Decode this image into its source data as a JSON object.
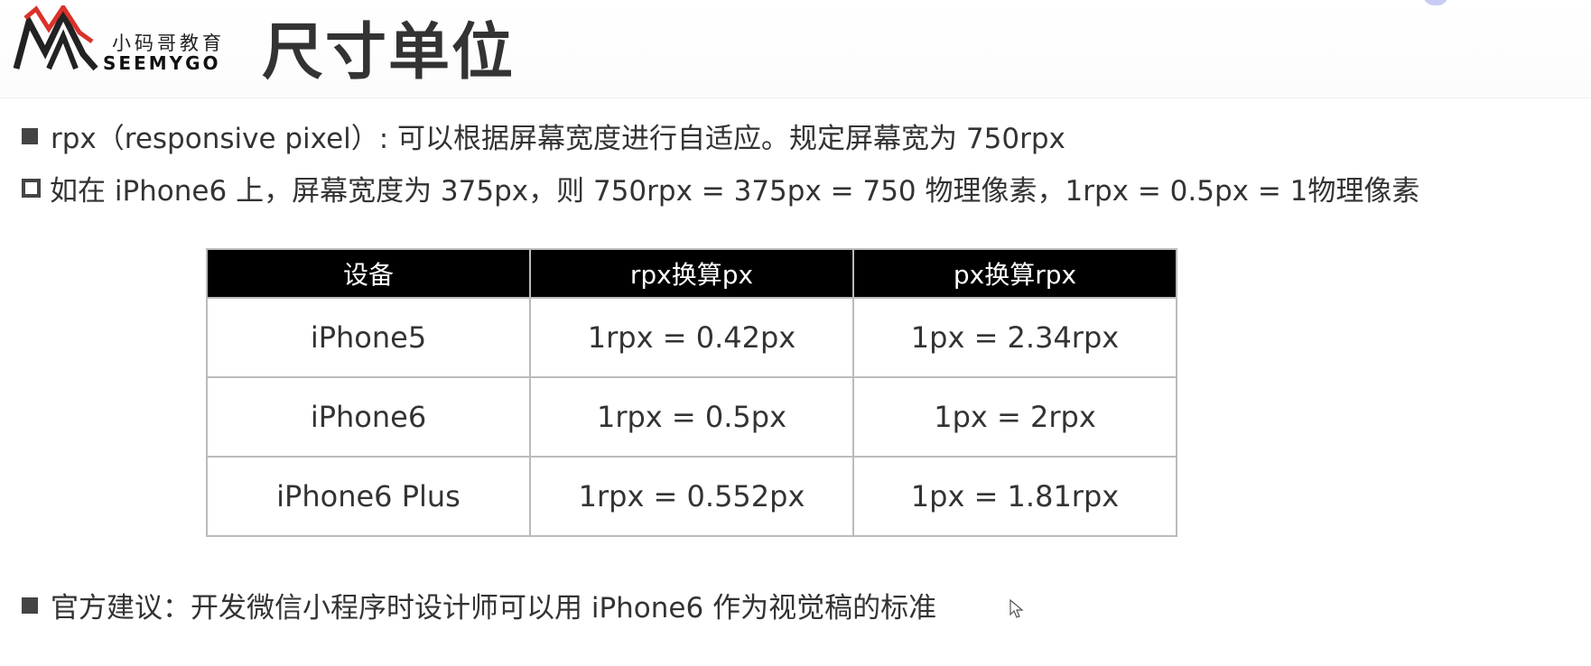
{
  "header": {
    "logo_cn": "小码哥教育",
    "logo_en": "SEEMYGO",
    "title": "尺寸单位"
  },
  "bullets": [
    {
      "style": "filled-square",
      "text": "rpx（responsive pixel）: 可以根据屏幕宽度进行自适应。规定屏幕宽为 750rpx"
    },
    {
      "style": "hollow-square",
      "text": "如在 iPhone6 上，屏幕宽度为 375px，则 750rpx = 375px = 750 物理像素，1rpx = 0.5px = 1物理像素"
    },
    {
      "style": "filled-square",
      "text": "官方建议：开发微信小程序时设计师可以用 iPhone6 作为视觉稿的标准"
    }
  ],
  "table": {
    "headers": [
      "设备",
      "rpx换算px",
      "px换算rpx"
    ],
    "rows": [
      [
        "iPhone5",
        "1rpx = 0.42px",
        "1px = 2.34rpx"
      ],
      [
        "iPhone6",
        "1rpx = 0.5px",
        "1px = 2rpx"
      ],
      [
        "iPhone6 Plus",
        "1rpx = 0.552px",
        "1px = 1.81rpx"
      ]
    ]
  },
  "colors": {
    "logo_red": "#d9322b",
    "logo_black": "#222222",
    "table_header_bg": "#000000",
    "text": "#333333"
  },
  "icons": [
    "seemygo-logo-icon",
    "bullet-square-icon",
    "bullet-hollow-square-icon",
    "mouse-cursor-icon"
  ]
}
